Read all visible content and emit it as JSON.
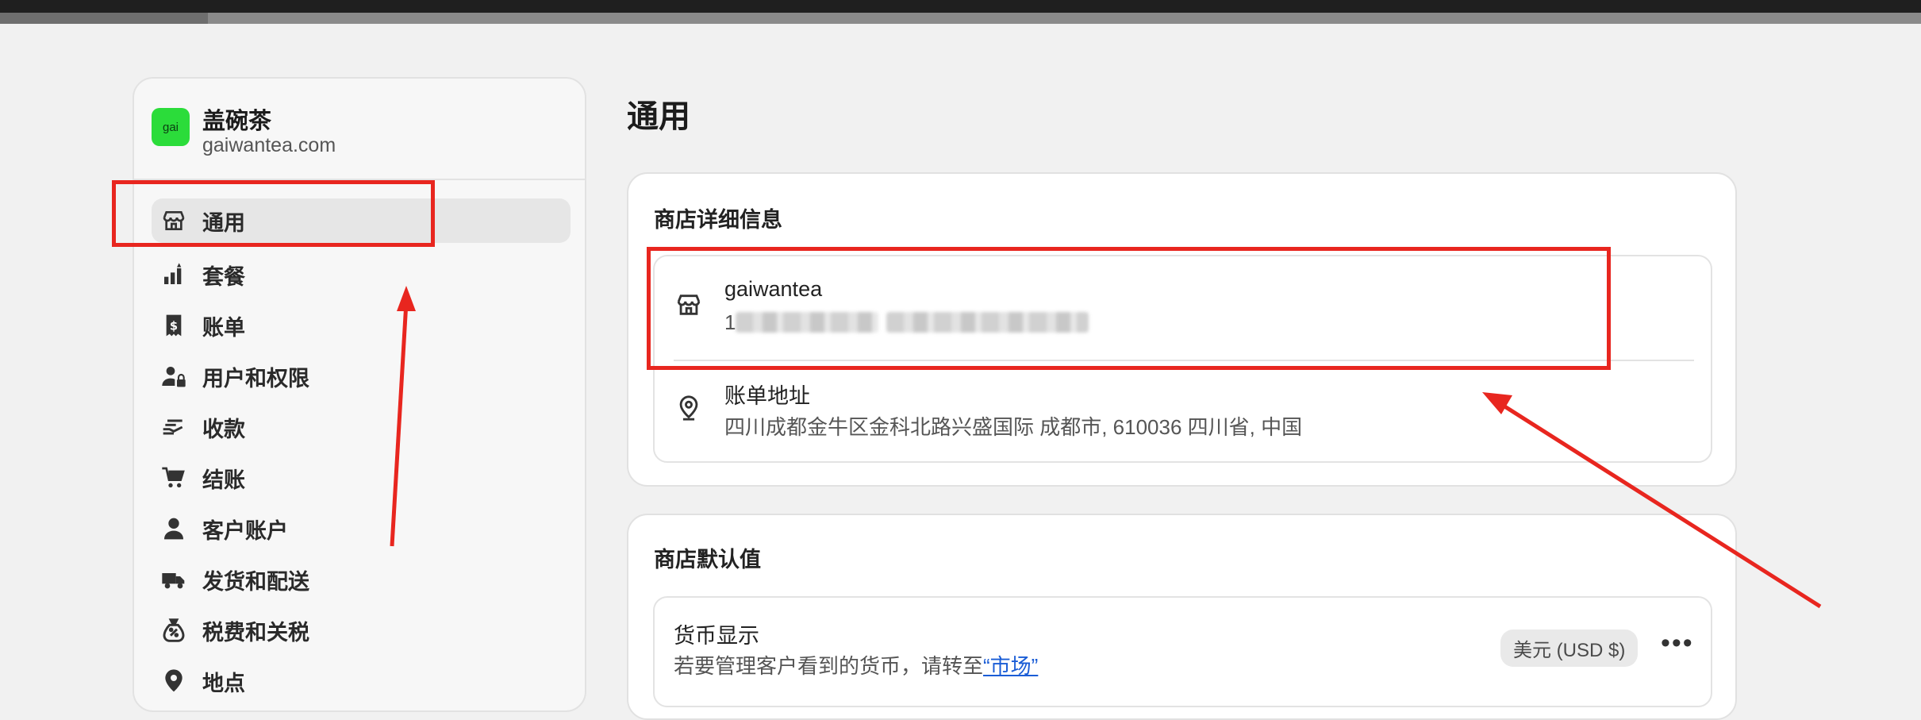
{
  "shop": {
    "avatar_text": "gai",
    "name": "盖碗茶",
    "domain": "gaiwantea.com"
  },
  "sidebar": {
    "items": [
      {
        "label": "通用",
        "icon": "store-icon",
        "active": true
      },
      {
        "label": "套餐",
        "icon": "plan-icon"
      },
      {
        "label": "账单",
        "icon": "billing-icon"
      },
      {
        "label": "用户和权限",
        "icon": "users-lock-icon"
      },
      {
        "label": "收款",
        "icon": "payment-hand-icon"
      },
      {
        "label": "结账",
        "icon": "cart-icon"
      },
      {
        "label": "客户账户",
        "icon": "person-icon"
      },
      {
        "label": "发货和配送",
        "icon": "truck-icon"
      },
      {
        "label": "税费和关税",
        "icon": "tax-bag-icon"
      },
      {
        "label": "地点",
        "icon": "location-pin-icon"
      }
    ]
  },
  "main": {
    "title": "通用",
    "store_details": {
      "title": "商店详细信息",
      "store_name": "gaiwantea",
      "store_phone_visible_prefix": "1",
      "billing_label": "账单地址",
      "billing_address": "四川成都金牛区金科北路兴盛国际 成都市, 610036 四川省, 中国"
    },
    "store_defaults": {
      "title": "商店默认值",
      "currency_label": "货币显示",
      "currency_hint": "若要管理客户看到的货币，请转至",
      "currency_link": "“市场”",
      "currency_value": "美元 (USD $)",
      "more_label": "•••"
    }
  },
  "annotations": {
    "highlight_color": "#e8261f"
  }
}
